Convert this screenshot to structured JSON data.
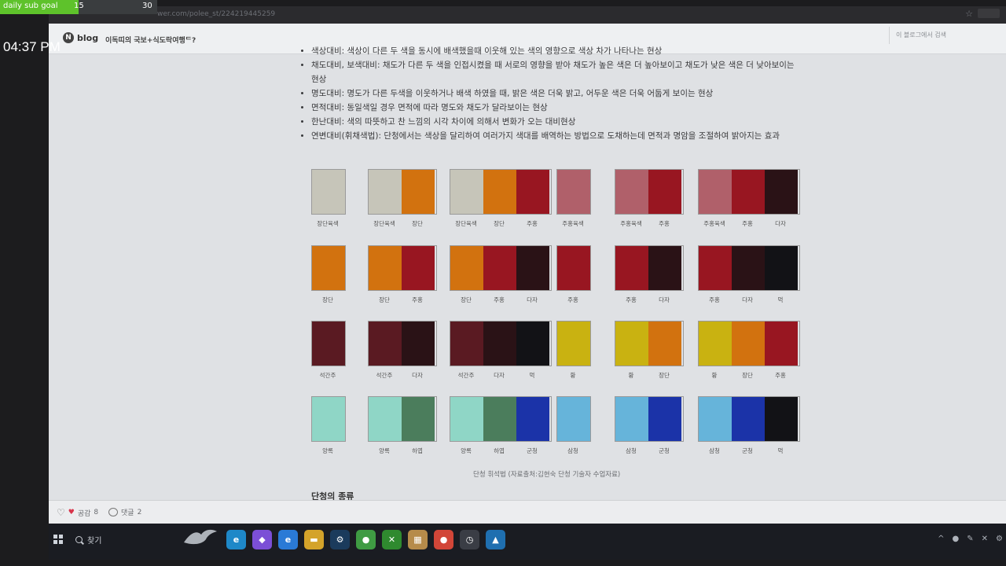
{
  "overlay": {
    "goal_label": "daily sub goal",
    "goal_current": "15",
    "goal_max": "30",
    "goal_progress": 0.5,
    "clock": "04:37 PM"
  },
  "browser": {
    "url": "wer.com/polee_st/224219445259",
    "star_icon": "☆"
  },
  "blog": {
    "logo_letter": "N",
    "logo_word": "blog",
    "title": "이독띠의 국보+식도락여행ᄃ?",
    "search_placeholder": "이 블로그에서 검색"
  },
  "bullets": [
    "색상대비: 색상이 다른 두 색을 동시에 배색했을때 이웃해 있는 색의 영향으로 색상 차가 나타나는 현상",
    "채도대비, 보색대비: 채도가 다른 두 색을 인접시켰을 때 서로의 영향을 받아 채도가 높은 색은 더 높아보이고 채도가 낮은 색은 더 낮아보이는 현상",
    "명도대비: 명도가 다른 두색을 이웃하거나 배색 하였을 때, 밝은 색은 더욱 밝고, 어두운 색은 더욱 어둡게 보이는 현상",
    "면적대비: 동일색일 경우 면적에 따라 명도와 채도가 달라보이는 현상",
    "한난대비: 색의 따뜻하고 찬 느낌의 시각 차이에 의해서 변화가 오는 대비현상",
    "연변대비(휘채색법): 단청에서는 색상을 달리하여 여러가지 색대를 배역하는 방법으로 도채하는데 면적과 명암을 조절하여 밝아지는 효과"
  ],
  "palette": {
    "장단육색": "#c6c5b9",
    "장단": "#d2720f",
    "주홍": "#981621",
    "주홍육색": "#b0606a",
    "다자": "#2a1216",
    "먹": "#121216",
    "석간주": "#5a1a22",
    "황": "#c9b211",
    "양록": "#8fd6c6",
    "하엽": "#4b7d5c",
    "군청": "#1b33a8",
    "삼청": "#66b4da"
  },
  "swatch_rows": [
    [
      [
        "장단육색"
      ],
      [
        "장단육색",
        "장단"
      ],
      [
        "장단육색",
        "장단",
        "주홍"
      ],
      [
        "주홍육색"
      ],
      [
        "주홍육색",
        "주홍"
      ],
      [
        "주홍육색",
        "주홍",
        "다자"
      ]
    ],
    [
      [
        "장단"
      ],
      [
        "장단",
        "주홍"
      ],
      [
        "장단",
        "주홍",
        "다자"
      ],
      [
        "주홍"
      ],
      [
        "주홍",
        "다자"
      ],
      [
        "주홍",
        "다자",
        "먹"
      ]
    ],
    [
      [
        "석간주"
      ],
      [
        "석간주",
        "다자"
      ],
      [
        "석간주",
        "다자",
        "먹"
      ],
      [
        "황"
      ],
      [
        "황",
        "장단"
      ],
      [
        "황",
        "장단",
        "주홍"
      ]
    ],
    [
      [
        "양록"
      ],
      [
        "양록",
        "하엽"
      ],
      [
        "양록",
        "하엽",
        "군청"
      ],
      [
        "삼청"
      ],
      [
        "삼청",
        "군청"
      ],
      [
        "삼청",
        "군청",
        "먹"
      ]
    ]
  ],
  "caption": "단청 휘석법 (자료출처:김현숙 단청 기술자 수업자료)",
  "heading": "단청의 종류",
  "reactions": {
    "like_label": "공감",
    "like_count": "8",
    "comment_label": "댓글",
    "comment_count": "2"
  },
  "taskbar": {
    "search_text": "찾기",
    "apps": [
      {
        "name": "edge",
        "glyph": "e",
        "color": "#1e88c8"
      },
      {
        "name": "copilot",
        "glyph": "◆",
        "color": "#7b4fd6"
      },
      {
        "name": "ie",
        "glyph": "e",
        "color": "#2a7ad6"
      },
      {
        "name": "file-explorer",
        "glyph": "▬",
        "color": "#d4a32a"
      },
      {
        "name": "steam",
        "glyph": "⚙",
        "color": "#1b3b5c"
      },
      {
        "name": "chrome",
        "glyph": "●",
        "color": "#3f9b43"
      },
      {
        "name": "xbox",
        "glyph": "✕",
        "color": "#2f8a2f"
      },
      {
        "name": "storage",
        "glyph": "▦",
        "color": "#b68b4a"
      },
      {
        "name": "chrome-active",
        "glyph": "●",
        "color": "#d24638"
      },
      {
        "name": "clock-app",
        "glyph": "◷",
        "color": "#3a3d45"
      },
      {
        "name": "photos",
        "glyph": "▲",
        "color": "#1f6fb0"
      }
    ]
  }
}
